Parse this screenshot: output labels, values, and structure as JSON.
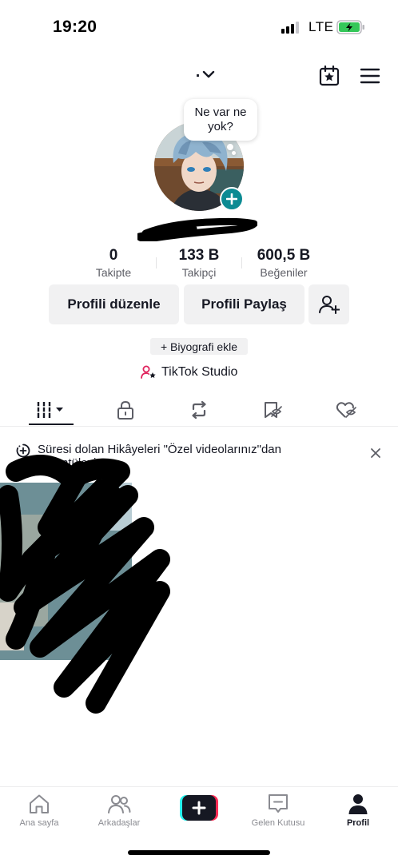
{
  "status_bar": {
    "time": "19:20",
    "network": "LTE"
  },
  "profile": {
    "bubble_text": "Ne var ne yok?",
    "switch_glyph": "."
  },
  "stats": [
    {
      "value": "0",
      "label": "Takipte"
    },
    {
      "value": "133 B",
      "label": "Takipçi"
    },
    {
      "value": "600,5 B",
      "label": "Beğeniler"
    }
  ],
  "actions": {
    "edit_profile": "Profili düzenle",
    "share_profile": "Profili Paylaş",
    "add_bio": "+ Biyografi ekle",
    "studio": "TikTok Studio"
  },
  "banner": {
    "text": "Süresi dolan Hikâyeleri \"Özel videolarınız\"dan görüntüleyin"
  },
  "nav": {
    "home": "Ana sayfa",
    "friends": "Arkadaşlar",
    "inbox": "Gelen Kutusu",
    "profile": "Profil"
  },
  "colors": {
    "accent_teal": "#0c8b93",
    "studio_pink": "#e0245e",
    "text": "#161823",
    "muted": "#5d5e66",
    "button_bg": "#f1f1f2",
    "battery_green": "#34c759"
  },
  "icons": {
    "calendar": "calendar-star-icon",
    "menu": "hamburger-menu-icon",
    "tab_grid": "grid-icon",
    "tab_private": "lock-icon",
    "tab_repost": "repost-icon",
    "tab_favorites": "bookmark-icon",
    "tab_liked": "heart-icon"
  }
}
